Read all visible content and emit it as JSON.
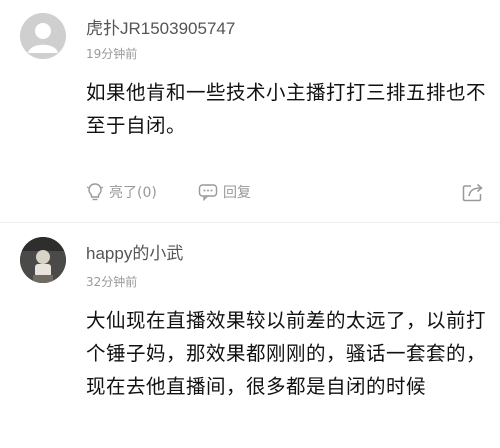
{
  "comments": [
    {
      "username": "虎扑JR1503905747",
      "time": "19分钟前",
      "text": "如果他肯和一些技术小主播打打三排五排也不至于自闭。",
      "like_label": "亮了(0)",
      "reply_label": "回复",
      "icons": {
        "avatar": "default-avatar-icon",
        "like": "lightbulb-icon",
        "reply": "chat-bubble-icon",
        "share": "share-icon"
      }
    },
    {
      "username": "happy的小武",
      "time": "32分钟前",
      "text": "大仙现在直播效果较以前差的太远了，以前打个锤子妈，那效果都刚刚的，骚话一套套的，现在去他直播间，很多都是自闭的时候"
    }
  ],
  "colors": {
    "meta": "#999999",
    "text": "#111111",
    "username": "#555555"
  }
}
